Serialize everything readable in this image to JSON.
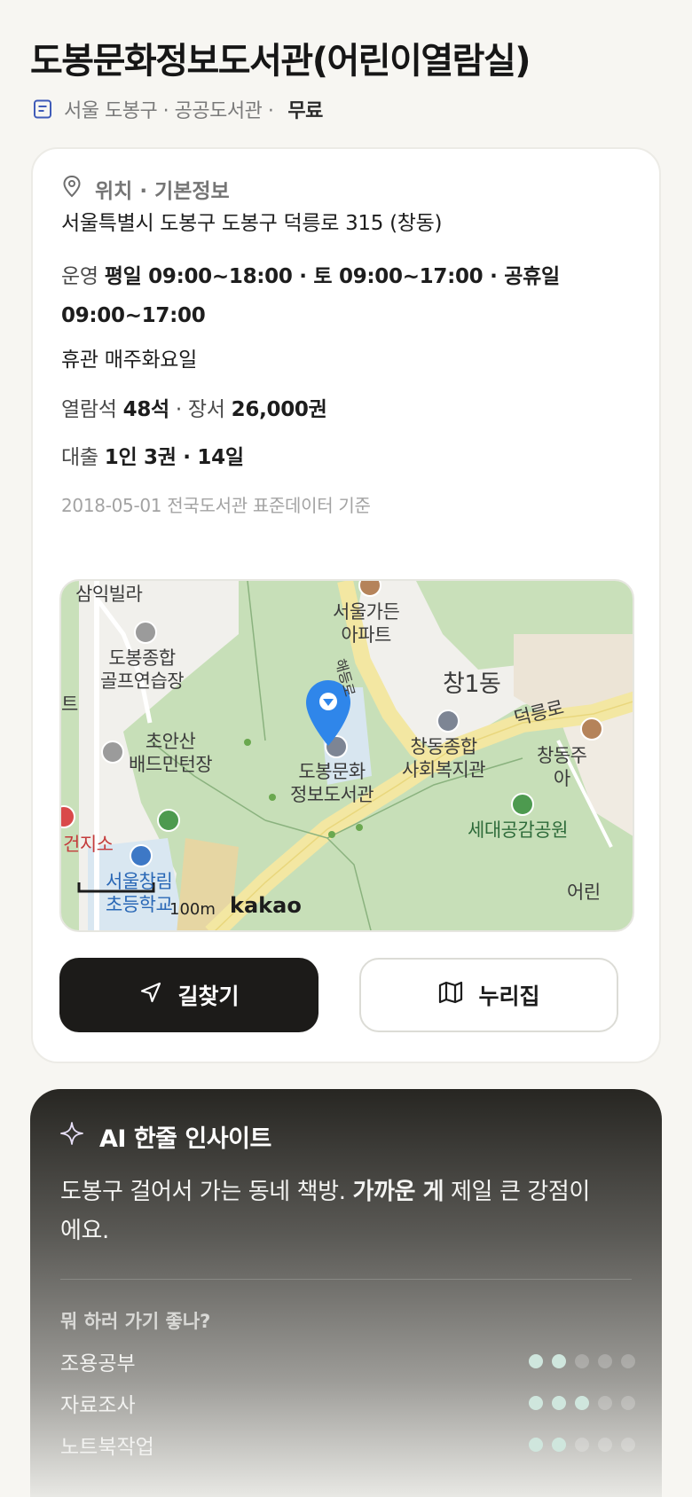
{
  "header": {
    "title": "도봉문화정보도서관(어린이열람실)",
    "meta": "서울 도봉구 · 공공도서관 ·",
    "fee": "무료"
  },
  "info": {
    "section_title": "위치 · 기본정보",
    "address": "서울특별시 도봉구 도봉구 덕릉로 315 (창동)",
    "hours_label": "운영",
    "hours_line1": "평일 09:00~18:00 · 토 09:00~17:00 · 공휴일",
    "hours_line2": "09:00~17:00",
    "closed": "휴관 매주화요일",
    "seats_label": "열람석",
    "seats_value": "48석",
    "books_label": "· 장서",
    "books_value": "26,000권",
    "loan_label": "대출",
    "loan_value": "1인 3권 · 14일",
    "source": "2018-05-01 전국도서관 표준데이터 기준"
  },
  "map": {
    "labels": {
      "samik": "삼익빌라",
      "garden_1": "서울가든",
      "garden_2": "아파트",
      "golf_1": "도봉종합",
      "golf_2": "골프연습장",
      "badminton_1": "초안산",
      "badminton_2": "배드민턴장",
      "changdong": "창1동",
      "deokneung": "덕릉로",
      "welfare_1": "창동종합",
      "welfare_2": "사회복지관",
      "library_1": "도봉문화",
      "library_2": "정보도서관",
      "changdong_apt_1": "창동주",
      "changdong_apt_2": "아",
      "park": "세대공감공원",
      "health": "건지소",
      "school_1": "서울창림",
      "school_2": "초등학교",
      "road": "해등로",
      "edge_left": "트",
      "edge_right": "어린"
    },
    "scale": "100m",
    "provider": "kakao"
  },
  "actions": {
    "directions": "길찾기",
    "nurizip": "누리집"
  },
  "ai": {
    "title": "AI 한줄 인사이트",
    "text_pre": "도봉구 걸어서 가는 동네 책방. ",
    "text_bold": "가까운 게",
    "text_post": " 제일 큰 강점이에요.",
    "subtitle": "뭐 하러 가기 좋나?",
    "ratings": [
      {
        "label": "조용공부",
        "score": 2,
        "max": 5
      },
      {
        "label": "자료조사",
        "score": 3,
        "max": 5
      },
      {
        "label": "노트북작업",
        "score": 2,
        "max": 5
      }
    ]
  }
}
